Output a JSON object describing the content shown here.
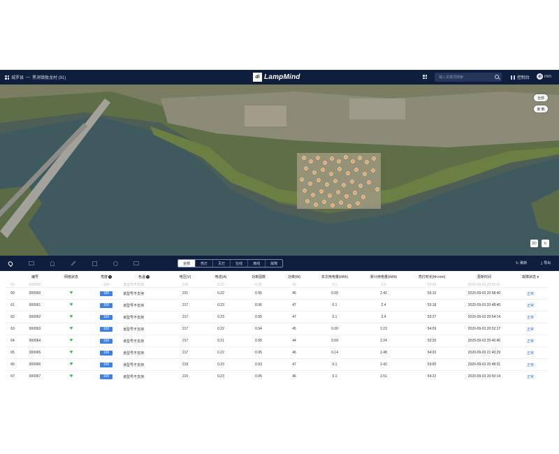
{
  "header": {
    "breadcrumb_root": "城罗县",
    "breadcrumb_sep": "—",
    "breadcrumb_current": "黑洞镇敖龙村 (91)",
    "brand_mark": "di",
    "brand_name": "LampMind",
    "search_placeholder": "输入关键词搜索",
    "control_label": "控制台",
    "user_initials": "dl",
    "user_name": "mm"
  },
  "map": {
    "btn_all": "全部",
    "btn_cluster": "离 散",
    "btn_2d": "2D",
    "btn_rotate": "↻"
  },
  "tabbar": {
    "filters": [
      "全部",
      "亮灯",
      "灭灯",
      "在线",
      "离线",
      "故障"
    ],
    "refresh_label": "刷新",
    "export_label": "导出"
  },
  "table": {
    "columns": [
      "",
      "编号",
      "网络状态",
      "亮度",
      "色温",
      "电压(V)",
      "电流(A)",
      "功率因数",
      "功率(W)",
      "本次用电量(kWh)",
      "累计用电量(kWh)",
      "亮灯时长(hh:mm)",
      "更新时间",
      "故障状态"
    ],
    "ghost_row": [
      "59",
      "000059",
      "",
      "100",
      "该型号不支持",
      "218",
      "0.22",
      "0.95",
      "45",
      "0.1",
      "2.3",
      "53:09",
      "2020-09-03 20:55:01",
      ""
    ],
    "rows": [
      [
        "60",
        "000060",
        "",
        "100",
        "该型号不支持",
        "221",
        "0.22",
        "0.95",
        "46",
        "0.09",
        "2.42",
        "53:10",
        "2020-09-03 20:58:40",
        "正常"
      ],
      [
        "61",
        "000061",
        "",
        "100",
        "该型号不支持",
        "217",
        "0.23",
        "0.96",
        "47",
        "0.1",
        "2.4",
        "53:18",
        "2020-09-03 20:48:40",
        "正常"
      ],
      [
        "62",
        "000062",
        "",
        "100",
        "该型号不支持",
        "217",
        "0.23",
        "0.95",
        "47",
        "0.1",
        "2.4",
        "53:27",
        "2020-09-03 20:54:14",
        "正常"
      ],
      [
        "63",
        "000063",
        "",
        "100",
        "该型号不支持",
        "217",
        "0.22",
        "0.94",
        "45",
        "0.09",
        "2.23",
        "54:09",
        "2020-09-03 20:52:17",
        "正常"
      ],
      [
        "64",
        "000064",
        "",
        "100",
        "该型号不支持",
        "217",
        "0.21",
        "0.95",
        "44",
        "0.09",
        "2.24",
        "53:20",
        "2020-09-03 20:40:40",
        "正常"
      ],
      [
        "65",
        "000065",
        "",
        "100",
        "该型号不支持",
        "217",
        "0.22",
        "0.95",
        "46",
        "0.14",
        "2.48",
        "54:20",
        "2020-09-03 21:40:29",
        "正常"
      ],
      [
        "66",
        "000066",
        "",
        "100",
        "该型号不支持",
        "219",
        "0.23",
        "0.93",
        "47",
        "0.1",
        "2.42",
        "53:00",
        "2020-09-03 20:48:31",
        "正常"
      ],
      [
        "67",
        "000067",
        "",
        "100",
        "该型号不支持",
        "215",
        "0.23",
        "0.95",
        "46",
        "0.1",
        "2.51",
        "54:22",
        "2020-09-03 20:50:14",
        "正常"
      ]
    ]
  },
  "colors": {
    "header_bg": "#0f1e3d",
    "accent": "#3b82e6",
    "online": "#3ebd5c",
    "marker": "#f0a050"
  }
}
